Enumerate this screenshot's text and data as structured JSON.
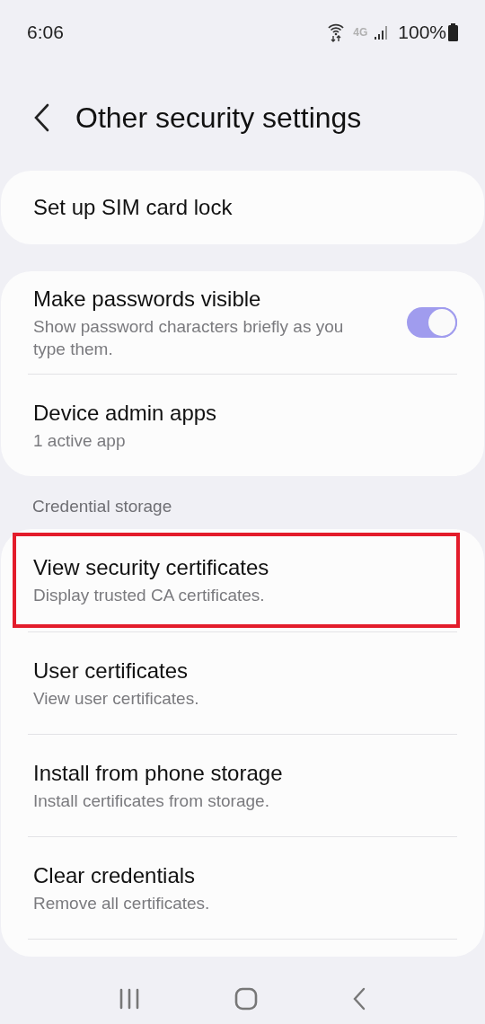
{
  "status_bar": {
    "time": "6:06",
    "network": "4G",
    "battery": "100%"
  },
  "header": {
    "title": "Other security settings"
  },
  "groups": [
    {
      "items": [
        {
          "title": "Set up SIM card lock"
        }
      ]
    },
    {
      "items": [
        {
          "title": "Make passwords visible",
          "subtitle": "Show password characters briefly as you type them.",
          "toggle": {
            "on": true
          }
        },
        {
          "title": "Device admin apps",
          "subtitle": "1 active app"
        }
      ]
    },
    {
      "heading": "Credential storage",
      "items": [
        {
          "title": "View security certificates",
          "subtitle": "Display trusted CA certificates.",
          "highlighted": true
        },
        {
          "title": "User certificates",
          "subtitle": "View user certificates.",
          "highlighted": false
        },
        {
          "title": "Install from phone storage",
          "subtitle": "Install certificates from storage.",
          "highlighted": false
        },
        {
          "title": "Clear credentials",
          "subtitle": "Remove all certificates.",
          "highlighted": false
        }
      ],
      "more_below": true
    }
  ]
}
